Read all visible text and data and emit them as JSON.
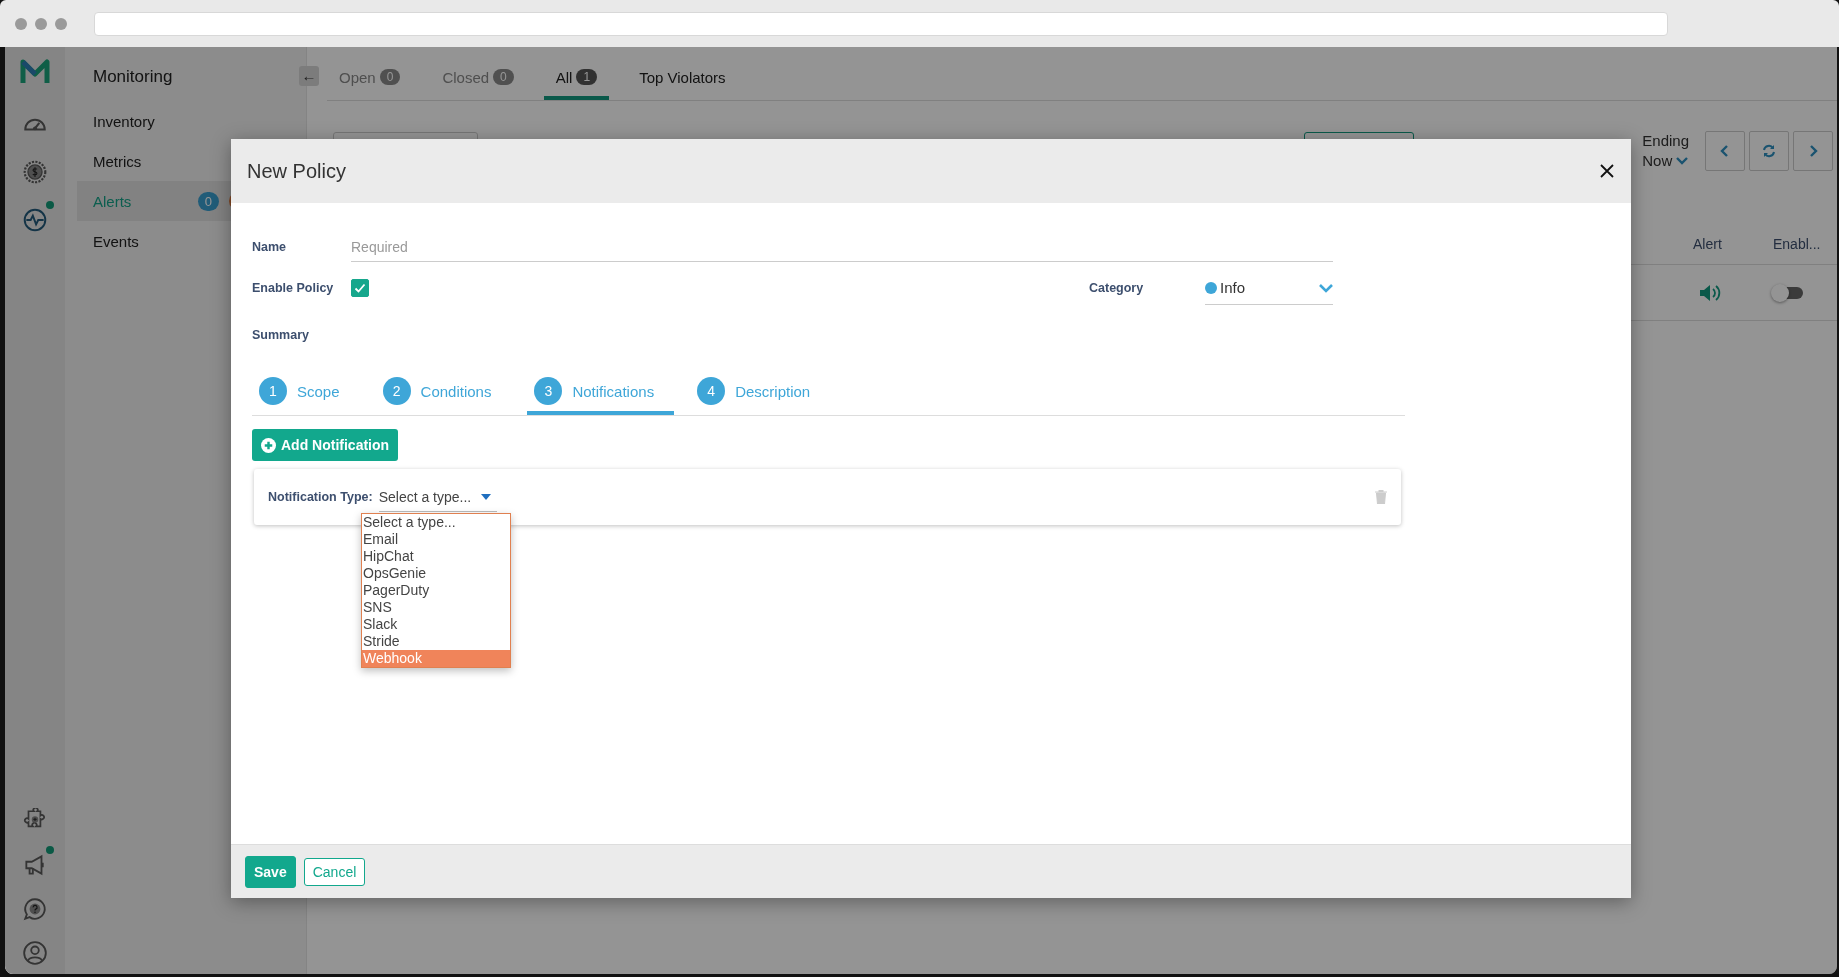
{
  "rail": {
    "top": [
      {
        "kind": "gauge",
        "dot": false
      },
      {
        "kind": "dollar",
        "dot": false
      },
      {
        "kind": "pulse",
        "dot": true
      }
    ],
    "bottom": [
      {
        "kind": "puzzle",
        "dot": false
      },
      {
        "kind": "megaphone",
        "dot": true
      },
      {
        "kind": "help",
        "dot": false
      },
      {
        "kind": "user",
        "dot": false
      }
    ]
  },
  "sidebar": {
    "title": "Monitoring",
    "items": [
      {
        "label": "Inventory",
        "selected": false
      },
      {
        "label": "Metrics",
        "selected": false
      },
      {
        "label": "Alerts",
        "selected": true,
        "badge": "0"
      },
      {
        "label": "Events",
        "selected": false
      }
    ]
  },
  "back_button": "←",
  "tabs": [
    {
      "label": "Open",
      "count": "0",
      "selected": false
    },
    {
      "label": "Closed",
      "count": "0",
      "selected": false
    },
    {
      "label": "All",
      "count": "1",
      "selected": true
    },
    {
      "label": "Top Violators",
      "selected": false
    }
  ],
  "toolbar": {
    "ending_label": "Ending",
    "ending_value": "Now"
  },
  "table": {
    "columns": [
      "Alert",
      "Enabl..."
    ],
    "rows": [
      {
        "enabled": false
      }
    ]
  },
  "modal": {
    "title": "New Policy",
    "name_label": "Name",
    "name_placeholder": "Required",
    "enable_label": "Enable Policy",
    "enable_checked": true,
    "category_label": "Category",
    "category_value": "Info",
    "summary_label": "Summary",
    "steps": [
      {
        "number": "1",
        "label": "Scope",
        "selected": false
      },
      {
        "number": "2",
        "label": "Conditions",
        "selected": false
      },
      {
        "number": "3",
        "label": "Notifications",
        "selected": true
      },
      {
        "number": "4",
        "label": "Description",
        "selected": false
      }
    ],
    "add_button": "Add Notification",
    "notification": {
      "label": "Notification Type:",
      "value": "Select a type...",
      "options": [
        {
          "label": "Select a type...",
          "highlighted": false
        },
        {
          "label": "Email",
          "highlighted": false
        },
        {
          "label": "HipChat",
          "highlighted": false
        },
        {
          "label": "OpsGenie",
          "highlighted": false
        },
        {
          "label": "PagerDuty",
          "highlighted": false
        },
        {
          "label": "SNS",
          "highlighted": false
        },
        {
          "label": "Slack",
          "highlighted": false
        },
        {
          "label": "Stride",
          "highlighted": false
        },
        {
          "label": "Webhook",
          "highlighted": true
        }
      ]
    },
    "save_button": "Save",
    "cancel_button": "Cancel"
  }
}
